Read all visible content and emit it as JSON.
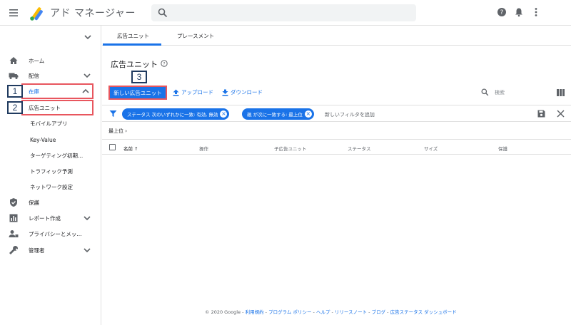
{
  "app": {
    "title": "アド マネージャー"
  },
  "sidebar": {
    "items": [
      {
        "label": "ホーム",
        "icon": "home-icon"
      },
      {
        "label": "配信",
        "icon": "truck-icon"
      },
      {
        "label": "在庫",
        "icon": "inventory-icon"
      },
      {
        "label": "広告ユニット"
      },
      {
        "label": "モバイルアプリ"
      },
      {
        "label": "Key-Value"
      },
      {
        "label": "ターゲティング初期..."
      },
      {
        "label": "トラフィック予測"
      },
      {
        "label": "ネットワーク設定"
      },
      {
        "label": "保護",
        "icon": "shield-icon"
      },
      {
        "label": "レポート作成",
        "icon": "bar-chart-icon"
      },
      {
        "label": "プライバシーとメッ...",
        "icon": "privacy-icon"
      },
      {
        "label": "管理者",
        "icon": "wrench-icon"
      }
    ]
  },
  "annotations": {
    "step1": "1",
    "step2": "2",
    "step3": "3"
  },
  "tabs": [
    {
      "label": "広告ユニット"
    },
    {
      "label": "プレースメント"
    }
  ],
  "page": {
    "title": "広告ユニット"
  },
  "toolbar": {
    "new_label": "新しい広告ユニット",
    "upload_label": "アップロード",
    "download_label": "ダウンロード",
    "search_label": "検索"
  },
  "filters": {
    "chip1": "ステータス 次のいずれかに一致: 有効, 無効",
    "chip2": "親 が次に一致する: 最上位",
    "add_label": "新しいフィルタを追加"
  },
  "breadcrumb": {
    "label": "最上位",
    "sep": "›"
  },
  "table": {
    "columns": [
      "名前",
      "操作",
      "子広告ユニット",
      "ステータス",
      "サイズ",
      "保護"
    ],
    "sort_arrow": "↑"
  },
  "footer": {
    "copyright": "© 2020 Google",
    "links": [
      "利用規約",
      "プログラム ポリシー",
      "ヘルプ",
      "リリースノート",
      "ブログ",
      "広告ステータス ダッシュボード"
    ],
    "sep": " - "
  },
  "colors": {
    "accent": "#1a73e8",
    "annotation_red": "#e8565e",
    "annotation_navy": "#1f3a5f"
  }
}
